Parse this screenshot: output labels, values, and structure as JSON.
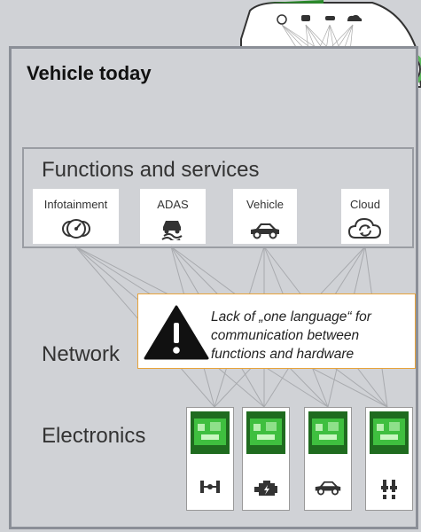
{
  "title": "Vehicle today",
  "functions": {
    "title": "Functions and services",
    "cards": [
      {
        "label": "Infotainment",
        "icon": "gauges-icon"
      },
      {
        "label": "ADAS",
        "icon": "skidding-car-icon"
      },
      {
        "label": "Vehicle",
        "icon": "car-icon"
      },
      {
        "label": "Cloud",
        "icon": "cloud-sync-icon"
      }
    ]
  },
  "network_label": "Network",
  "electronics_label": "Electronics",
  "warning": {
    "text": "Lack of „one language“ for communication between functions  and hardware",
    "icon": "warning-icon",
    "border_color": "#e8a33a"
  },
  "hardware": [
    {
      "icon": "axle-icon"
    },
    {
      "icon": "engine-icon"
    },
    {
      "icon": "car-icon"
    },
    {
      "icon": "spark-plug-icon"
    }
  ],
  "colors": {
    "background": "#d0d2d6",
    "frame": "#8b8f97",
    "wheel": "#5cb85c",
    "board": "#2f9a2f"
  }
}
